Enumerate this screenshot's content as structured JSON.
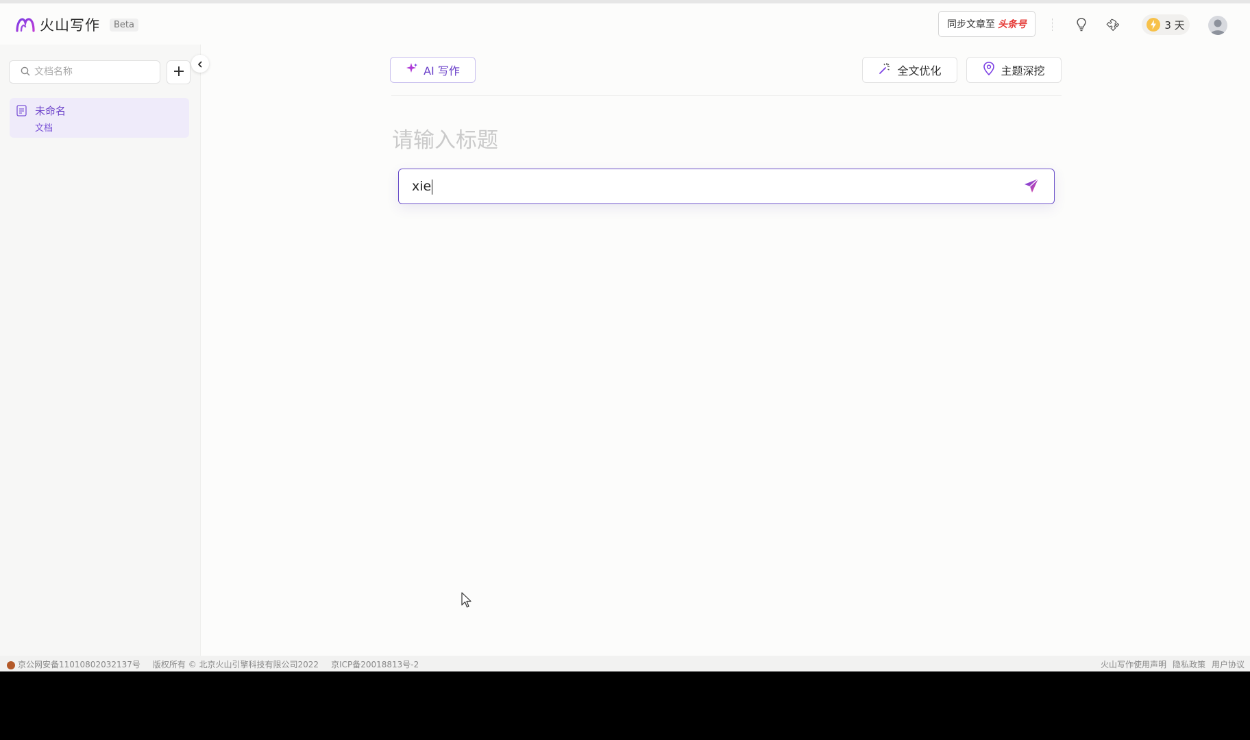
{
  "header": {
    "app_name": "火山写作",
    "beta_label": "Beta",
    "sync_prefix": "同步文章至",
    "sync_brand": "头条号",
    "days_label": "3 天"
  },
  "sidebar": {
    "search_placeholder": "文档名称",
    "documents": [
      {
        "title": "未命名",
        "type": "文档"
      }
    ]
  },
  "toolbar": {
    "ai_write_label": "AI 写作",
    "optimize_label": "全文优化",
    "deep_dig_label": "主题深挖"
  },
  "editor": {
    "title_placeholder": "请输入标题",
    "prompt_value": "xie"
  },
  "footer": {
    "beian": "京公网安备11010802032137号",
    "copyright": "版权所有 © 北京火山引擎科技有限公司2022",
    "icp": "京ICP备20018813号-2",
    "links": [
      "火山写作使用声明",
      "隐私政策",
      "用户协议"
    ]
  },
  "colors": {
    "accent": "#6a3fc9",
    "accent_light": "#efebfa",
    "brand_red": "#e53935"
  }
}
